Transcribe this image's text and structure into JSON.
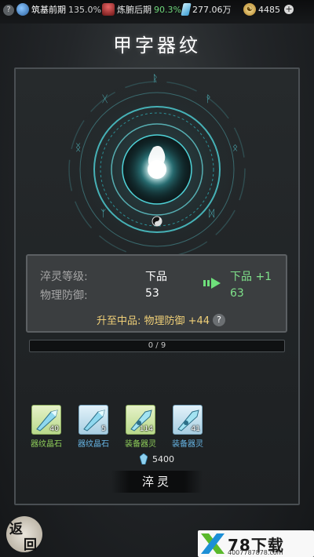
{
  "topbar": {
    "help_icon": "question-icon",
    "realm_main": {
      "name": "筑基前期",
      "pct": "135.0%"
    },
    "realm_body": {
      "name": "炼腑后期",
      "pct": "90.3%"
    },
    "spirit_stone": "277.06万",
    "gold": "4485",
    "add_icon": "plus-icon"
  },
  "title": "甲字器纹",
  "info": {
    "level_label": "淬灵等级:",
    "level_current": "下品",
    "level_next": "下品 +1",
    "def_label": "物理防御:",
    "def_current": "53",
    "def_next": "63",
    "tip": "升至中品: 物理防御 +44",
    "tip_icon": "question-icon"
  },
  "progress": {
    "text": "0 / 9",
    "value": 0,
    "max": 9
  },
  "items": [
    {
      "name": "器纹晶石",
      "count": "40",
      "color": "green"
    },
    {
      "name": "器纹晶石",
      "count": "5",
      "color": "blue"
    },
    {
      "name": "装备器灵",
      "count": "114",
      "color": "green"
    },
    {
      "name": "装备器灵",
      "count": "41",
      "color": "blue"
    }
  ],
  "cost": "5400",
  "temper_button": "淬灵",
  "back_button": {
    "line1": "返",
    "line2": "回"
  },
  "watermark": {
    "brand": "78下载",
    "url": "4007787878.com"
  },
  "colors": {
    "accent_green": "#7fe08a",
    "gold_text": "#f0d078",
    "ring_cyan": "#4fd3d8"
  }
}
